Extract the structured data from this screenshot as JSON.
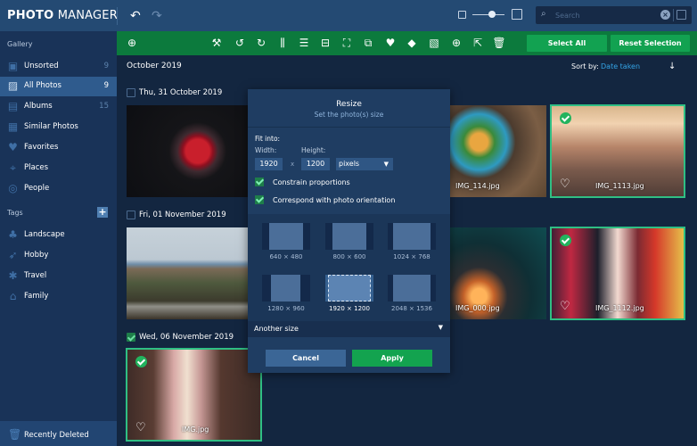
{
  "app": {
    "title_bold": "PHOTO",
    "title_rest": "MANAGER"
  },
  "topbar": {
    "undo_icon": "undo-icon",
    "redo_icon": "redo-icon",
    "search_placeholder": "Search",
    "search_value": ""
  },
  "sidebar": {
    "gallery_heading": "Gallery",
    "items": [
      {
        "label": "Unsorted",
        "count": "9",
        "icon": "unsorted-icon"
      },
      {
        "label": "All Photos",
        "count": "9",
        "icon": "photos-icon",
        "active": true
      },
      {
        "label": "Albums",
        "count": "15",
        "icon": "albums-icon"
      },
      {
        "label": "Similar Photos",
        "count": "",
        "icon": "similar-icon"
      },
      {
        "label": "Favorites",
        "count": "",
        "icon": "heart-icon"
      },
      {
        "label": "Places",
        "count": "",
        "icon": "place-icon"
      },
      {
        "label": "People",
        "count": "",
        "icon": "people-icon"
      }
    ],
    "tags_heading": "Tags",
    "add_tag_label": "+",
    "tags": [
      {
        "label": "Landscape",
        "icon": "tree-icon"
      },
      {
        "label": "Hobby",
        "icon": "shuttlecock-icon"
      },
      {
        "label": "Travel",
        "icon": "palm-icon"
      },
      {
        "label": "Family",
        "icon": "house-icon"
      }
    ],
    "footer_label": "Recently Deleted"
  },
  "toolbar": {
    "select_all": "Select All",
    "reset_selection": "Reset Selection"
  },
  "main": {
    "month": "October 2019",
    "sort_label": "Sort by:",
    "sort_value": "Date taken",
    "groups": [
      {
        "date": "Thu, 31 October 2019",
        "checked": false
      },
      {
        "date": "Fri, 01 November 2019",
        "checked": false
      },
      {
        "date": "Wed, 06 November 2019",
        "checked": true
      }
    ],
    "photos": [
      {
        "name": "",
        "selected": false
      },
      {
        "name": "IMG_114.jpg",
        "selected": false
      },
      {
        "name": "IMG_1113.jpg",
        "selected": true
      },
      {
        "name": "",
        "selected": false
      },
      {
        "name": "IMG_000.jpg",
        "selected": false
      },
      {
        "name": "IMG_1112.jpg",
        "selected": true
      },
      {
        "name": "IMG.jpg",
        "selected": true
      }
    ]
  },
  "modal": {
    "title": "Resize",
    "subtitle": "Set the photo(s) size",
    "fit_into": "Fit into:",
    "width_label": "Width:",
    "height_label": "Height:",
    "width_value": "1920",
    "height_value": "1200",
    "times": "x",
    "unit": "pixels",
    "constrain": "Constrain proportions",
    "orientation": "Correspond with photo orientation",
    "presets": [
      "640 × 480",
      "800 × 600",
      "1024 × 768",
      "1280 × 960",
      "1920 × 1200",
      "2048 × 1536"
    ],
    "selected_preset": "1920 × 1200",
    "another_size": "Another size",
    "cancel": "Cancel",
    "apply": "Apply"
  },
  "colors": {
    "accent_green": "#0c7a3d",
    "button_green": "#12a251",
    "sidebar_bg": "#193358",
    "selection_outline": "#2fbf84",
    "link_blue": "#34a4e6"
  }
}
